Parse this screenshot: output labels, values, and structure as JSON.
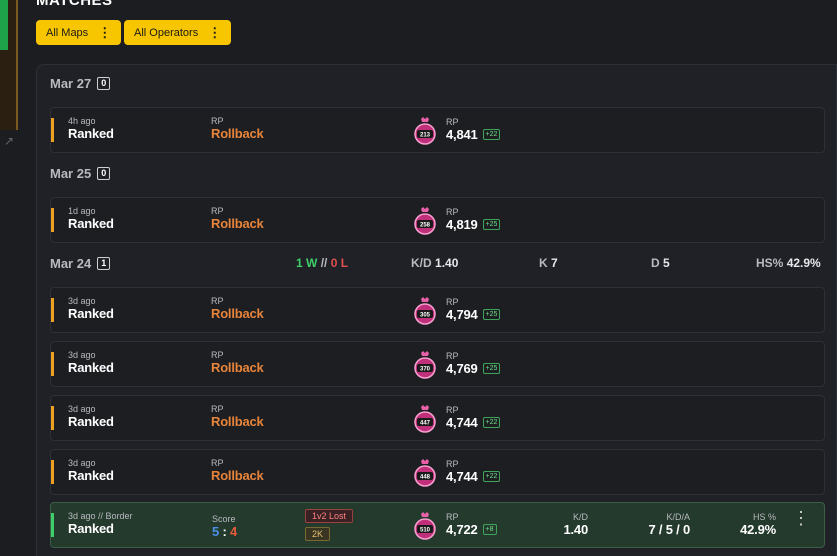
{
  "title": "MATCHES",
  "filters": {
    "maps": "All Maps",
    "operators": "All Operators"
  },
  "colors": {
    "accent": "#f7c600",
    "rollback": "#e8843a",
    "win": "#3fcf6a",
    "loss": "#e05050"
  },
  "groups": [
    {
      "date": "Mar 27",
      "count": "0"
    },
    {
      "date": "Mar 25",
      "count": "0"
    },
    {
      "date": "Mar 24",
      "count": "1",
      "summary": {
        "wins": "1 W",
        "sep": "//",
        "losses": "0 L",
        "kd_label": "K/D",
        "kd": "1.40",
        "k_label": "K",
        "k": "7",
        "d_label": "D",
        "d": "5",
        "hs_label": "HS%",
        "hs": "42.9%"
      }
    }
  ],
  "matches": [
    {
      "time": "4h ago",
      "mode": "Ranked",
      "rp_label": "RP",
      "result": "Rollback",
      "rank": "213",
      "rp": "4,841",
      "delta": "+22"
    },
    {
      "time": "1d ago",
      "mode": "Ranked",
      "rp_label": "RP",
      "result": "Rollback",
      "rank": "258",
      "rp": "4,819",
      "delta": "+25"
    },
    {
      "time": "3d ago",
      "mode": "Ranked",
      "rp_label": "RP",
      "result": "Rollback",
      "rank": "305",
      "rp": "4,794",
      "delta": "+25"
    },
    {
      "time": "3d ago",
      "mode": "Ranked",
      "rp_label": "RP",
      "result": "Rollback",
      "rank": "370",
      "rp": "4,769",
      "delta": "+25"
    },
    {
      "time": "3d ago",
      "mode": "Ranked",
      "rp_label": "RP",
      "result": "Rollback",
      "rank": "447",
      "rp": "4,744",
      "delta": "+22"
    },
    {
      "time": "3d ago",
      "mode": "Ranked",
      "rp_label": "RP",
      "result": "Rollback",
      "rank": "448",
      "rp": "4,744",
      "delta": "+22"
    }
  ],
  "last_match": {
    "time": "3d ago // Border",
    "mode": "Ranked",
    "score_label": "Score",
    "score_a": "5",
    "score_sep": ":",
    "score_b": "4",
    "badge_lost": "1v2 Lost",
    "badge_k": "2K",
    "rank": "510",
    "rp_label": "RP",
    "rp": "4,722",
    "delta": "+8",
    "kd_label": "K/D",
    "kd": "1.40",
    "kda_label": "K/D/A",
    "kda": "7 / 5 / 0",
    "hs_label": "HS %",
    "hs": "42.9%"
  }
}
